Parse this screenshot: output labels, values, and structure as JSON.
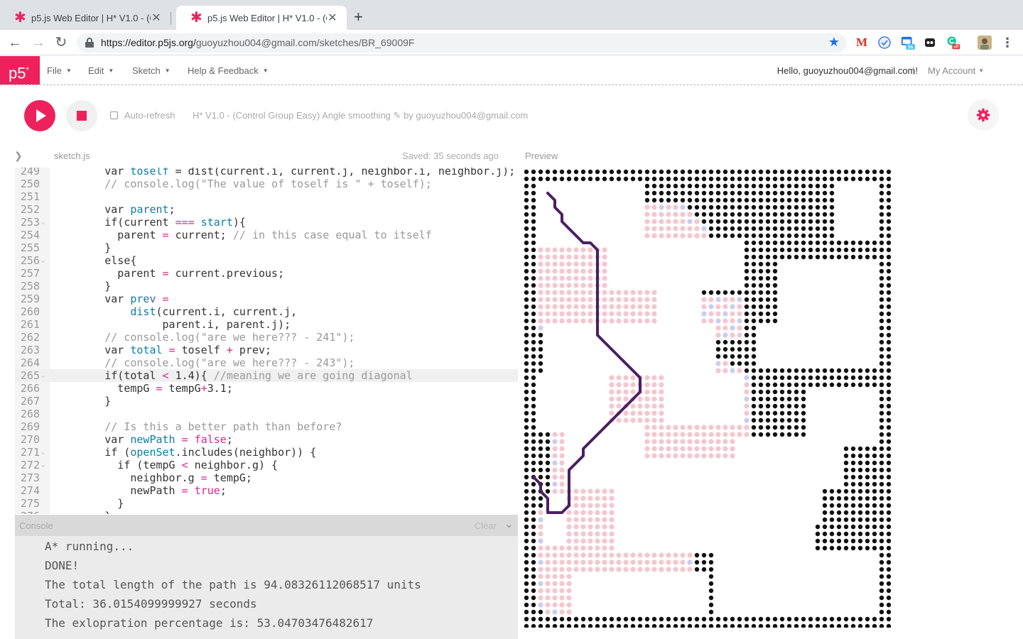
{
  "browser": {
    "tabs": [
      {
        "title": "p5.js Web Editor | H* V1.0 - (Co",
        "active": false
      },
      {
        "title": "p5.js Web Editor | H* V1.0 - (Co",
        "active": true
      }
    ],
    "url_host": "https://editor.p5js.org/",
    "url_path": "guoyuzhou004@gmail.com/sketches/BR_69009F",
    "extensions": [
      "gmail-icon",
      "shield-icon",
      "calendar-icon",
      "extension-icon",
      "grammarly-icon",
      "profile-avatar"
    ],
    "calendar_badge": "3h",
    "grammarly_badge": "off"
  },
  "menu": {
    "logo": "p5",
    "items": [
      "File",
      "Edit",
      "Sketch",
      "Help & Feedback"
    ],
    "hello": "Hello, guoyuzhou004@gmail.com!",
    "separator": "|",
    "account": "My Account"
  },
  "toolbar": {
    "autorefresh_label": "Auto-refresh",
    "sketch_name": "H* V1.0 - (Control Group Easy) Angle smoothing",
    "edit_icon": "✎",
    "byline": "by guoyuzhou004@gmail.com"
  },
  "editor": {
    "filename": "sketch.js",
    "saved": "Saved: 35 seconds ago",
    "preview_label": "Preview",
    "highlighted_line": 265,
    "lines": [
      {
        "n": "249",
        "fold": false,
        "code": [
          [
            "t-kw",
            "        var "
          ],
          [
            "t-def",
            "toself"
          ],
          [
            "t-kw",
            " = dist(current.i, current.j, neighbor.i, neighbor.j);"
          ]
        ]
      },
      {
        "n": "250",
        "fold": false,
        "code": [
          [
            "t-cm",
            "        // console.log(\"The value of toself is \" + toself);"
          ]
        ]
      },
      {
        "n": "251",
        "fold": false,
        "code": []
      },
      {
        "n": "252",
        "fold": false,
        "code": [
          [
            "t-kw",
            "        var "
          ],
          [
            "t-def",
            "parent"
          ],
          [
            "t-kw",
            ";"
          ]
        ]
      },
      {
        "n": "253",
        "fold": true,
        "code": [
          [
            "t-kw",
            "        if(current "
          ],
          [
            "t-op",
            "==="
          ],
          [
            "t-kw",
            " "
          ],
          [
            "t-def",
            "start"
          ],
          [
            "t-kw",
            "){"
          ]
        ]
      },
      {
        "n": "254",
        "fold": false,
        "code": [
          [
            "t-kw",
            "          parent "
          ],
          [
            "t-op",
            "="
          ],
          [
            "t-kw",
            " current; "
          ],
          [
            "t-cm",
            "// in this case equal to itself"
          ]
        ]
      },
      {
        "n": "255",
        "fold": false,
        "code": [
          [
            "t-kw",
            "        }"
          ]
        ]
      },
      {
        "n": "256",
        "fold": true,
        "code": [
          [
            "t-kw",
            "        else{"
          ]
        ]
      },
      {
        "n": "257",
        "fold": false,
        "code": [
          [
            "t-kw",
            "          parent "
          ],
          [
            "t-op",
            "="
          ],
          [
            "t-kw",
            " current.previous;"
          ]
        ]
      },
      {
        "n": "258",
        "fold": false,
        "code": [
          [
            "t-kw",
            "        }"
          ]
        ]
      },
      {
        "n": "259",
        "fold": false,
        "code": [
          [
            "t-kw",
            "        var "
          ],
          [
            "t-def",
            "prev"
          ],
          [
            "t-kw",
            " "
          ],
          [
            "t-op",
            "="
          ]
        ]
      },
      {
        "n": "260",
        "fold": false,
        "code": [
          [
            "t-kw",
            "            "
          ],
          [
            "t-def",
            "dist"
          ],
          [
            "t-kw",
            "(current.i, current.j,"
          ]
        ]
      },
      {
        "n": "261",
        "fold": false,
        "code": [
          [
            "t-kw",
            "                 parent.i, parent.j);"
          ]
        ]
      },
      {
        "n": "262",
        "fold": false,
        "code": [
          [
            "t-cm",
            "        // console.log(\"are we here??? - 241\");"
          ]
        ]
      },
      {
        "n": "263",
        "fold": false,
        "code": [
          [
            "t-kw",
            "        var "
          ],
          [
            "t-def",
            "total"
          ],
          [
            "t-kw",
            " "
          ],
          [
            "t-op",
            "="
          ],
          [
            "t-kw",
            " toself "
          ],
          [
            "t-op",
            "+"
          ],
          [
            "t-kw",
            " prev;"
          ]
        ]
      },
      {
        "n": "264",
        "fold": false,
        "code": [
          [
            "t-cm",
            "        // console.log(\"are we here??? - 243\");"
          ]
        ]
      },
      {
        "n": "265",
        "fold": true,
        "code": [
          [
            "t-kw",
            "        if(total "
          ],
          [
            "t-op",
            "<"
          ],
          [
            "t-kw",
            " 1.4){ "
          ],
          [
            "t-cm",
            "//meaning we are going diagonal"
          ]
        ]
      },
      {
        "n": "266",
        "fold": false,
        "code": [
          [
            "t-kw",
            "          tempG "
          ],
          [
            "t-op",
            "="
          ],
          [
            "t-kw",
            " tempG"
          ],
          [
            "t-op",
            "+"
          ],
          [
            "t-kw",
            "3.1;"
          ]
        ]
      },
      {
        "n": "267",
        "fold": false,
        "code": [
          [
            "t-kw",
            "        }"
          ]
        ]
      },
      {
        "n": "268",
        "fold": false,
        "code": []
      },
      {
        "n": "269",
        "fold": false,
        "code": [
          [
            "t-cm",
            "        // Is this a better path than before?"
          ]
        ]
      },
      {
        "n": "270",
        "fold": false,
        "code": [
          [
            "t-kw",
            "        var "
          ],
          [
            "t-def",
            "newPath"
          ],
          [
            "t-kw",
            " "
          ],
          [
            "t-op",
            "="
          ],
          [
            "t-kw",
            " "
          ],
          [
            "t-atom",
            "false"
          ],
          [
            "t-kw",
            ";"
          ]
        ]
      },
      {
        "n": "271",
        "fold": true,
        "code": [
          [
            "t-kw",
            "        if ("
          ],
          [
            "t-def",
            "openSet"
          ],
          [
            "t-kw",
            ".includes(neighbor)) {"
          ]
        ]
      },
      {
        "n": "272",
        "fold": true,
        "code": [
          [
            "t-kw",
            "          if (tempG "
          ],
          [
            "t-op",
            "<"
          ],
          [
            "t-kw",
            " neighbor.g) {"
          ]
        ]
      },
      {
        "n": "273",
        "fold": false,
        "code": [
          [
            "t-kw",
            "            neighbor.g "
          ],
          [
            "t-op",
            "="
          ],
          [
            "t-kw",
            " tempG;"
          ]
        ]
      },
      {
        "n": "274",
        "fold": false,
        "code": [
          [
            "t-kw",
            "            newPath "
          ],
          [
            "t-op",
            "="
          ],
          [
            "t-kw",
            " "
          ],
          [
            "t-atom",
            "true"
          ],
          [
            "t-kw",
            ";"
          ]
        ]
      },
      {
        "n": "275",
        "fold": false,
        "code": [
          [
            "t-kw",
            "          }"
          ]
        ]
      },
      {
        "n": "276",
        "fold": false,
        "code": [
          [
            "t-kw",
            "        }"
          ]
        ]
      }
    ]
  },
  "console": {
    "title": "Console",
    "clear": "Clear",
    "lines": [
      "A* running...",
      "DONE!",
      "The total length of the path is 94.08326112068517 units",
      "Total: 36.0154099999927 seconds",
      "The exlopration percentage is: 53.04703476482617"
    ]
  },
  "preview": {
    "colors": {
      "wall": "#111111",
      "closed": "#f5c6cf",
      "open": "#c9cdf2",
      "path": "#4b2063"
    },
    "path_nodes": [
      [
        3,
        3
      ],
      [
        4,
        4
      ],
      [
        4,
        5
      ],
      [
        5,
        6
      ],
      [
        5,
        7
      ],
      [
        6,
        8
      ],
      [
        7,
        9
      ],
      [
        8,
        10
      ],
      [
        9,
        10
      ],
      [
        10,
        11
      ],
      [
        10,
        12
      ],
      [
        10,
        13
      ],
      [
        10,
        14
      ],
      [
        10,
        15
      ],
      [
        10,
        16
      ],
      [
        10,
        17
      ],
      [
        10,
        18
      ],
      [
        10,
        19
      ],
      [
        10,
        20
      ],
      [
        10,
        21
      ],
      [
        10,
        22
      ],
      [
        10,
        23
      ],
      [
        11,
        24
      ],
      [
        12,
        25
      ],
      [
        13,
        26
      ],
      [
        14,
        27
      ],
      [
        15,
        28
      ],
      [
        16,
        29
      ],
      [
        16,
        30
      ],
      [
        16,
        31
      ],
      [
        15,
        32
      ],
      [
        14,
        33
      ],
      [
        13,
        34
      ],
      [
        12,
        35
      ],
      [
        11,
        36
      ],
      [
        10,
        37
      ],
      [
        9,
        38
      ],
      [
        8,
        39
      ],
      [
        8,
        40
      ],
      [
        7,
        41
      ],
      [
        6,
        42
      ],
      [
        6,
        43
      ],
      [
        6,
        44
      ],
      [
        6,
        45
      ],
      [
        6,
        46
      ],
      [
        6,
        47
      ],
      [
        5,
        48
      ],
      [
        4,
        48
      ],
      [
        3,
        48
      ],
      [
        3,
        47
      ],
      [
        3,
        46
      ],
      [
        2,
        45
      ],
      [
        2,
        44
      ],
      [
        1,
        43
      ]
    ]
  }
}
